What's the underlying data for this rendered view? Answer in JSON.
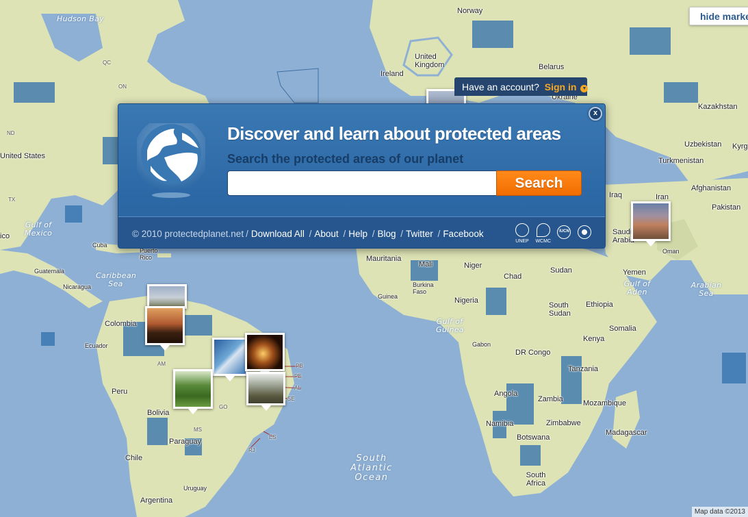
{
  "map": {
    "hide_markers_label": "hide markers",
    "attribution": "Map data ©2013",
    "ocean_labels": [
      "Hudson Bay",
      "Gulf of Mexico",
      "Caribbean Sea",
      "South Atlantic Ocean",
      "Arabian Sea",
      "Gulf of Aden",
      "Gulf of Guinea"
    ],
    "country_labels": [
      "Norway",
      "United Kingdom",
      "Ireland",
      "Belarus",
      "Ukraine",
      "Kazakhstan",
      "Uzbekistan",
      "Kyrgyzstan",
      "Turkmenistan",
      "Afghanistan",
      "Pakistan",
      "Iraq",
      "Iran",
      "Saudi Arabia",
      "Oman",
      "Yemen",
      "Mauritania",
      "Mali",
      "Niger",
      "Chad",
      "Sudan",
      "Burkina Faso",
      "Guinea",
      "Nigeria",
      "South Sudan",
      "Ethiopia",
      "Somalia",
      "Gabon",
      "Kenya",
      "DR Congo",
      "Tanzania",
      "Angola",
      "Zambia",
      "Mozambique",
      "Namibia",
      "Zimbabwe",
      "Botswana",
      "Madagascar",
      "South Africa",
      "United States",
      "Cuba",
      "Puerto Rico",
      "Guatemala",
      "Nicaragua",
      "Colombia",
      "Ecuador",
      "Peru",
      "Bolivia",
      "Paraguay",
      "Chile",
      "Argentina",
      "Uruguay"
    ],
    "state_labels": [
      "QC",
      "ON",
      "ND",
      "TX",
      "PB",
      "PE",
      "AL",
      "SE",
      "RJ",
      "ES",
      "GO",
      "MS",
      "AM",
      "ico"
    ]
  },
  "account": {
    "prompt": "Have an account?",
    "signin_label": "Sign in"
  },
  "panel": {
    "headline": "Discover and learn about protected areas",
    "subhead": "Search the protected areas of our planet",
    "search_placeholder": "",
    "search_value": "",
    "search_button": "Search",
    "close_label": "x",
    "copyright": "© 2010 protectedplanet.net",
    "links": [
      "Download All",
      "About",
      "Help",
      "Blog",
      "Twitter",
      "Facebook"
    ],
    "partners": [
      "UNEP",
      "WCMC",
      "IUCN",
      ""
    ]
  },
  "colors": {
    "panel": "#2d69a6",
    "footer": "#26568d",
    "search_button": "#f47b0a",
    "signin": "#f7a823",
    "ocean": "#8eb0d4",
    "land": "#dde3b5"
  }
}
